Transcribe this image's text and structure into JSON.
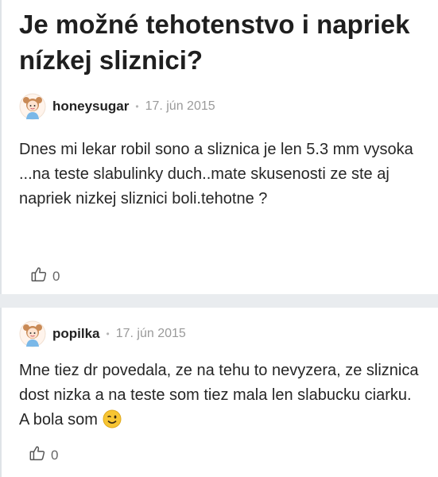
{
  "question": {
    "title": "Je možné tehotenstvo i napriek nízkej sliznici?",
    "author": "honeysugar",
    "date": "17. jún 2015",
    "body": "Dnes mi lekar robil sono a sliznica je len 5.3 mm vysoka ...na teste slabulinky duch..mate skusenosti ze ste aj napriek nizkej sliznici boli.tehotne ?",
    "likes": "0"
  },
  "reply": {
    "author": "popilka",
    "date": "17. jún 2015",
    "body": "Mne tiez dr povedala, ze na tehu to nevyzera, ze sliznica dost nizka a na teste som tiez mala len slabucku ciarku. A bola som",
    "emoji": "wink-emoji",
    "likes": "0"
  },
  "icons": {
    "avatar": "girl-avatar-icon",
    "like": "thumbs-up-icon"
  },
  "colors": {
    "background": "#e9ecef",
    "card": "#ffffff",
    "meta": "#9a9a9a",
    "emoji": "#f7c533"
  }
}
